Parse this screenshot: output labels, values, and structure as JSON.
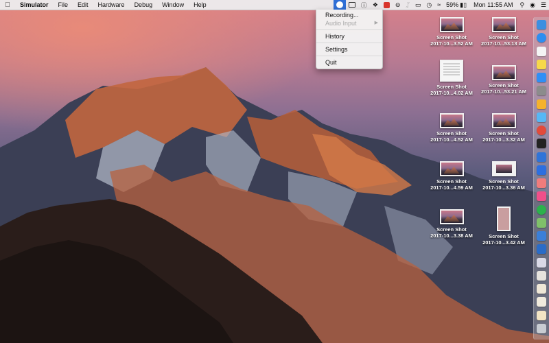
{
  "menubar": {
    "app_name": "Simulator",
    "menus": [
      "File",
      "Edit",
      "Hardware",
      "Debug",
      "Window",
      "Help"
    ],
    "battery": "59%",
    "clock": "Mon 11:55 AM"
  },
  "dropdown": {
    "items": [
      {
        "label": "Recording...",
        "enabled": true
      },
      {
        "label": "Audio Input",
        "enabled": false,
        "submenu": true
      },
      {
        "label": "History",
        "enabled": true
      },
      {
        "label": "Settings",
        "enabled": true
      },
      {
        "label": "Quit",
        "enabled": true
      }
    ]
  },
  "desktop": {
    "files": [
      {
        "name": "Screen Shot",
        "sub": "2017-10...3.52 AM",
        "kind": "shot"
      },
      {
        "name": "Screen Shot",
        "sub": "2017-10...53.13 AM",
        "kind": "shot"
      },
      {
        "name": "Screen Shot",
        "sub": "2017-10...4.02 AM",
        "kind": "doc"
      },
      {
        "name": "Screen Shot",
        "sub": "2017-10...53.21 AM",
        "kind": "shot"
      },
      {
        "name": "Screen Shot",
        "sub": "2017-10...4.52 AM",
        "kind": "shot"
      },
      {
        "name": "Screen Shot",
        "sub": "2017-10...3.32 AM",
        "kind": "shot"
      },
      {
        "name": "Screen Shot",
        "sub": "2017-10...4.59 AM",
        "kind": "shot"
      },
      {
        "name": "Screen Shot",
        "sub": "2017-10...3.36 AM",
        "kind": "frame"
      },
      {
        "name": "Screen Shot",
        "sub": "2017-10...3.38 AM",
        "kind": "shot"
      },
      {
        "name": "Screen Shot",
        "sub": "2017-10...3.42 AM",
        "kind": "pink"
      }
    ]
  },
  "dock": {
    "icons": [
      {
        "name": "finder-icon",
        "color": "#3d8fe0"
      },
      {
        "name": "safari-icon",
        "color": "#2d8ef0"
      },
      {
        "name": "calendar-icon",
        "color": "#f4f4f4"
      },
      {
        "name": "notes-icon",
        "color": "#f6d84a"
      },
      {
        "name": "app-store-icon",
        "color": "#2f8ff5"
      },
      {
        "name": "system-preferences-icon",
        "color": "#8c8c8c"
      },
      {
        "name": "sketch-icon",
        "color": "#f5b22c"
      },
      {
        "name": "messages-icon",
        "color": "#56b8f5"
      },
      {
        "name": "chrome-icon",
        "color": "#e24b3b"
      },
      {
        "name": "terminal-icon",
        "color": "#222222"
      },
      {
        "name": "xcode-icon",
        "color": "#2f74d8"
      },
      {
        "name": "dropbox-icon",
        "color": "#2c6fe0"
      },
      {
        "name": "photos-icon",
        "color": "#f07c7c"
      },
      {
        "name": "itunes-icon",
        "color": "#f14f8a"
      },
      {
        "name": "spotify-icon",
        "color": "#2bb24c"
      },
      {
        "name": "maps-icon",
        "color": "#7fc06a"
      },
      {
        "name": "simulator-icon",
        "color": "#3a7fd8"
      },
      {
        "name": "xcode-tools-icon",
        "color": "#2a6cc8"
      },
      {
        "name": "preview-icon",
        "color": "#d9d9e6"
      },
      {
        "name": "photo-stack-icon",
        "color": "#e6e3de"
      },
      {
        "name": "downloads-folder-icon",
        "color": "#efe7d7"
      },
      {
        "name": "documents-folder-icon",
        "color": "#f0eadd"
      },
      {
        "name": "screenshots-folder-icon",
        "color": "#f2e4c4"
      },
      {
        "name": "trash-icon",
        "color": "#c8ccd2"
      }
    ]
  }
}
